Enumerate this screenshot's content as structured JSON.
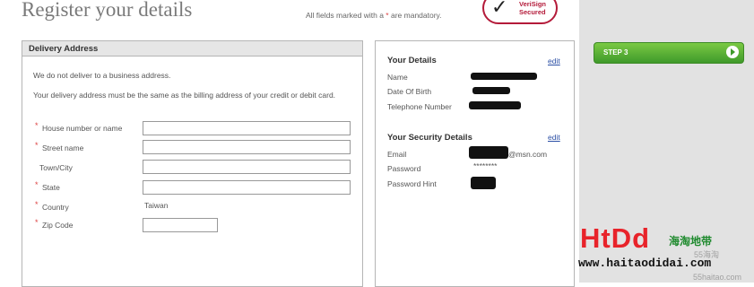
{
  "header": {
    "title": "Register your details",
    "mandatory_text": "All fields marked with a",
    "mandatory_star": "*",
    "mandatory_suffix": "are mandatory.",
    "verisign_line1": "VeriSign",
    "verisign_line2": "Secured"
  },
  "step_button": {
    "label": "STEP 3"
  },
  "delivery": {
    "title": "Delivery Address",
    "note1": "We do not deliver to a business address.",
    "note2": "Your delivery address must be the same as the billing address of your credit or debit card.",
    "fields": [
      {
        "label": "House number or name",
        "required": true,
        "value": ""
      },
      {
        "label": "Street name",
        "required": true,
        "value": ""
      },
      {
        "label": "Town/City",
        "required": false,
        "value": ""
      },
      {
        "label": "State",
        "required": true,
        "value": ""
      },
      {
        "label": "Country",
        "required": true,
        "value": "Taiwan"
      },
      {
        "label": "Zip Code",
        "required": true,
        "value": ""
      }
    ],
    "required_mark": "*"
  },
  "your_details": {
    "title": "Your Details",
    "edit": "edit",
    "name_label": "Name",
    "dob_label": "Date Of Birth",
    "phone_label": "Telephone Number"
  },
  "security_details": {
    "title": "Your Security Details",
    "edit": "edit",
    "email_label": "Email",
    "email_suffix": "@msn.com",
    "password_label": "Password",
    "password_value": "********",
    "hint_label": "Password Hint"
  },
  "watermark": {
    "brand": "HtDd",
    "chinese": "海淘地带",
    "url": "www.haitaodidai.com",
    "small1": "55海淘",
    "small2": "55haitao.com"
  }
}
